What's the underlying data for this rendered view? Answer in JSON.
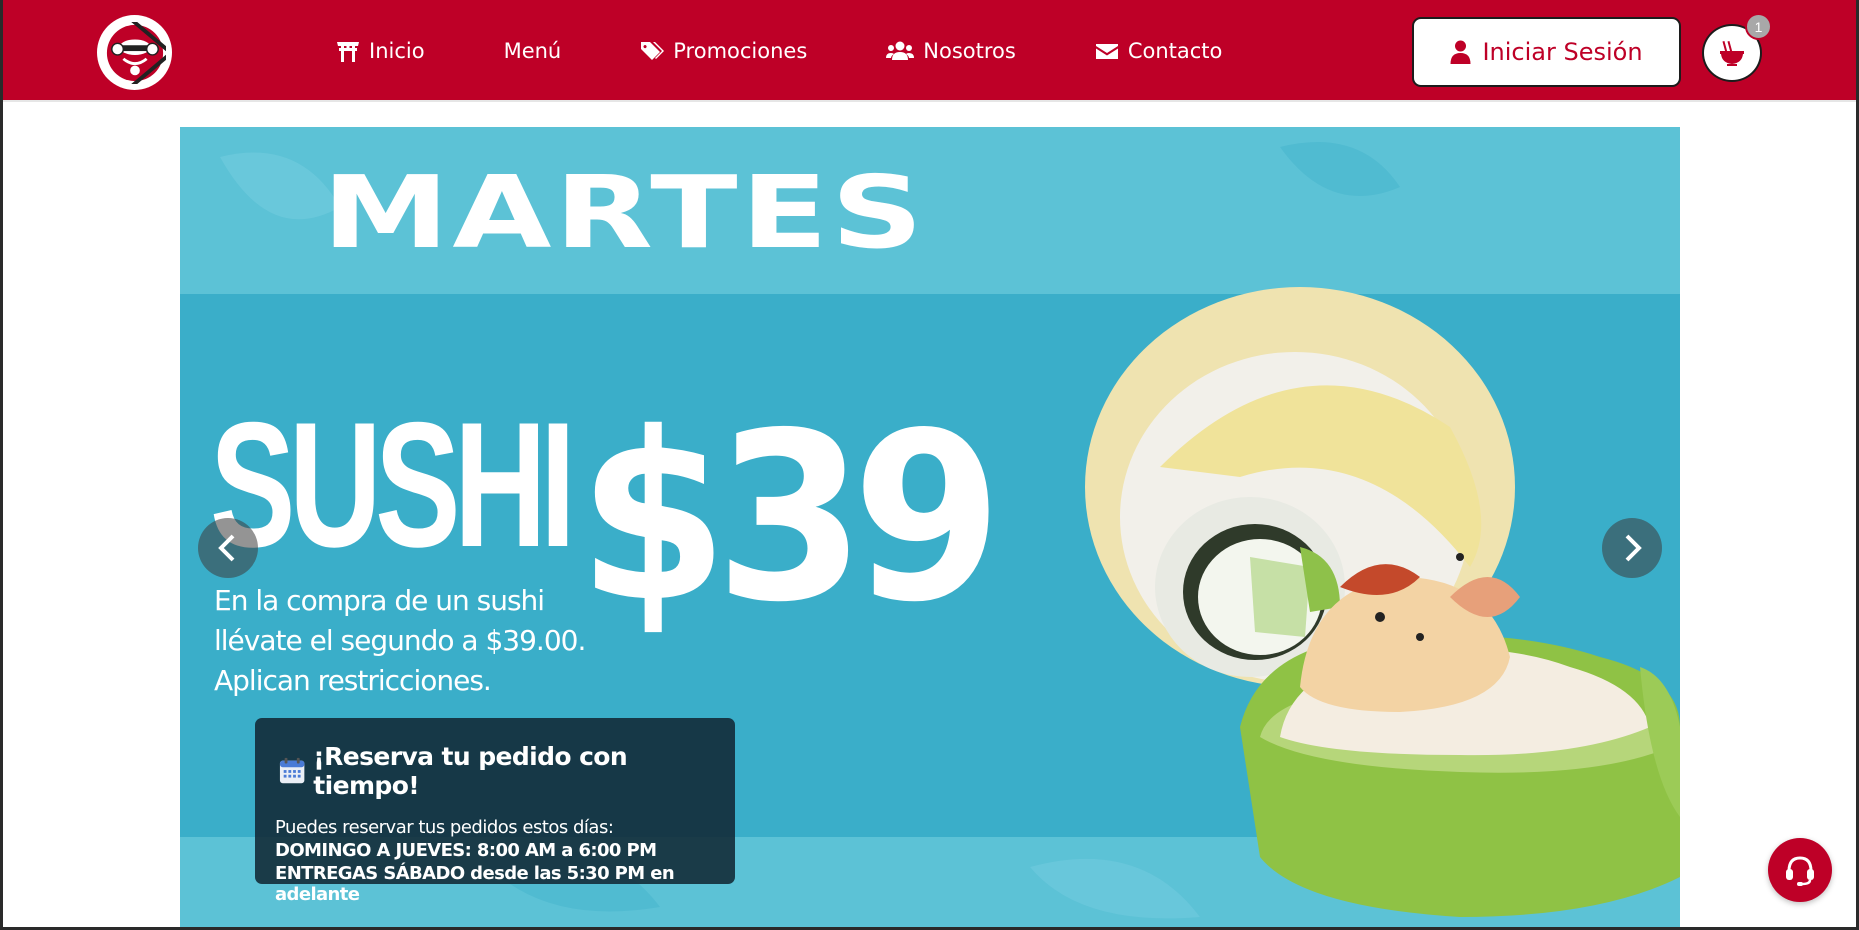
{
  "brand": {
    "logo_icon": "sushi-restaurant-logo",
    "primary_color": "#be0027"
  },
  "nav": {
    "items": [
      {
        "label": "Inicio",
        "icon": "torii-gate-icon"
      },
      {
        "label": "Menú",
        "icon": ""
      },
      {
        "label": "Promociones",
        "icon": "tags-icon"
      },
      {
        "label": "Nosotros",
        "icon": "users-icon"
      },
      {
        "label": "Contacto",
        "icon": "envelope-icon"
      }
    ],
    "login_label": "Iniciar Sesión",
    "cart_count": "1"
  },
  "carousel": {
    "slide": {
      "day": "MARTES",
      "product": "SUSHI",
      "price": "$39",
      "lines": [
        "En la compra de un sushi",
        "llévate el segundo a $39.00.",
        "Aplican restricciones."
      ],
      "background_color": "#3aaec9"
    }
  },
  "reservation": {
    "icon": "calendar-icon",
    "title": "¡Reserva tu pedido con tiempo!",
    "subtitle": "Puedes reservar tus pedidos estos días:",
    "schedule": [
      "DOMINGO A JUEVES: 8:00 AM a 6:00 PM",
      "ENTREGAS SÁBADO desde las 5:30 PM en adelante"
    ]
  },
  "support": {
    "icon": "headset-icon"
  }
}
